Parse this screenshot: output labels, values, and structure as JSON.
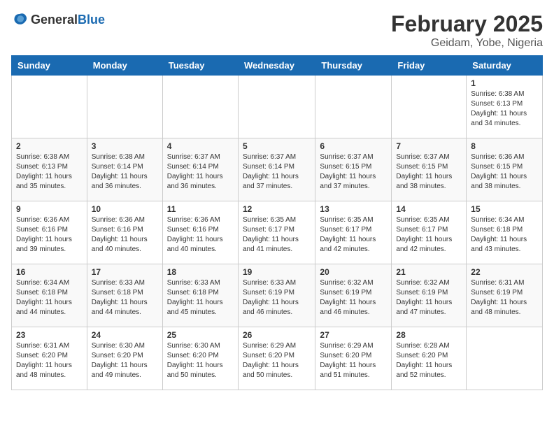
{
  "header": {
    "logo_general": "General",
    "logo_blue": "Blue",
    "month_title": "February 2025",
    "location": "Geidam, Yobe, Nigeria"
  },
  "weekdays": [
    "Sunday",
    "Monday",
    "Tuesday",
    "Wednesday",
    "Thursday",
    "Friday",
    "Saturday"
  ],
  "weeks": [
    [
      {
        "day": "",
        "info": ""
      },
      {
        "day": "",
        "info": ""
      },
      {
        "day": "",
        "info": ""
      },
      {
        "day": "",
        "info": ""
      },
      {
        "day": "",
        "info": ""
      },
      {
        "day": "",
        "info": ""
      },
      {
        "day": "1",
        "info": "Sunrise: 6:38 AM\nSunset: 6:13 PM\nDaylight: 11 hours and 34 minutes."
      }
    ],
    [
      {
        "day": "2",
        "info": "Sunrise: 6:38 AM\nSunset: 6:13 PM\nDaylight: 11 hours and 35 minutes."
      },
      {
        "day": "3",
        "info": "Sunrise: 6:38 AM\nSunset: 6:14 PM\nDaylight: 11 hours and 36 minutes."
      },
      {
        "day": "4",
        "info": "Sunrise: 6:37 AM\nSunset: 6:14 PM\nDaylight: 11 hours and 36 minutes."
      },
      {
        "day": "5",
        "info": "Sunrise: 6:37 AM\nSunset: 6:14 PM\nDaylight: 11 hours and 37 minutes."
      },
      {
        "day": "6",
        "info": "Sunrise: 6:37 AM\nSunset: 6:15 PM\nDaylight: 11 hours and 37 minutes."
      },
      {
        "day": "7",
        "info": "Sunrise: 6:37 AM\nSunset: 6:15 PM\nDaylight: 11 hours and 38 minutes."
      },
      {
        "day": "8",
        "info": "Sunrise: 6:36 AM\nSunset: 6:15 PM\nDaylight: 11 hours and 38 minutes."
      }
    ],
    [
      {
        "day": "9",
        "info": "Sunrise: 6:36 AM\nSunset: 6:16 PM\nDaylight: 11 hours and 39 minutes."
      },
      {
        "day": "10",
        "info": "Sunrise: 6:36 AM\nSunset: 6:16 PM\nDaylight: 11 hours and 40 minutes."
      },
      {
        "day": "11",
        "info": "Sunrise: 6:36 AM\nSunset: 6:16 PM\nDaylight: 11 hours and 40 minutes."
      },
      {
        "day": "12",
        "info": "Sunrise: 6:35 AM\nSunset: 6:17 PM\nDaylight: 11 hours and 41 minutes."
      },
      {
        "day": "13",
        "info": "Sunrise: 6:35 AM\nSunset: 6:17 PM\nDaylight: 11 hours and 42 minutes."
      },
      {
        "day": "14",
        "info": "Sunrise: 6:35 AM\nSunset: 6:17 PM\nDaylight: 11 hours and 42 minutes."
      },
      {
        "day": "15",
        "info": "Sunrise: 6:34 AM\nSunset: 6:18 PM\nDaylight: 11 hours and 43 minutes."
      }
    ],
    [
      {
        "day": "16",
        "info": "Sunrise: 6:34 AM\nSunset: 6:18 PM\nDaylight: 11 hours and 44 minutes."
      },
      {
        "day": "17",
        "info": "Sunrise: 6:33 AM\nSunset: 6:18 PM\nDaylight: 11 hours and 44 minutes."
      },
      {
        "day": "18",
        "info": "Sunrise: 6:33 AM\nSunset: 6:18 PM\nDaylight: 11 hours and 45 minutes."
      },
      {
        "day": "19",
        "info": "Sunrise: 6:33 AM\nSunset: 6:19 PM\nDaylight: 11 hours and 46 minutes."
      },
      {
        "day": "20",
        "info": "Sunrise: 6:32 AM\nSunset: 6:19 PM\nDaylight: 11 hours and 46 minutes."
      },
      {
        "day": "21",
        "info": "Sunrise: 6:32 AM\nSunset: 6:19 PM\nDaylight: 11 hours and 47 minutes."
      },
      {
        "day": "22",
        "info": "Sunrise: 6:31 AM\nSunset: 6:19 PM\nDaylight: 11 hours and 48 minutes."
      }
    ],
    [
      {
        "day": "23",
        "info": "Sunrise: 6:31 AM\nSunset: 6:20 PM\nDaylight: 11 hours and 48 minutes."
      },
      {
        "day": "24",
        "info": "Sunrise: 6:30 AM\nSunset: 6:20 PM\nDaylight: 11 hours and 49 minutes."
      },
      {
        "day": "25",
        "info": "Sunrise: 6:30 AM\nSunset: 6:20 PM\nDaylight: 11 hours and 50 minutes."
      },
      {
        "day": "26",
        "info": "Sunrise: 6:29 AM\nSunset: 6:20 PM\nDaylight: 11 hours and 50 minutes."
      },
      {
        "day": "27",
        "info": "Sunrise: 6:29 AM\nSunset: 6:20 PM\nDaylight: 11 hours and 51 minutes."
      },
      {
        "day": "28",
        "info": "Sunrise: 6:28 AM\nSunset: 6:20 PM\nDaylight: 11 hours and 52 minutes."
      },
      {
        "day": "",
        "info": ""
      }
    ]
  ]
}
